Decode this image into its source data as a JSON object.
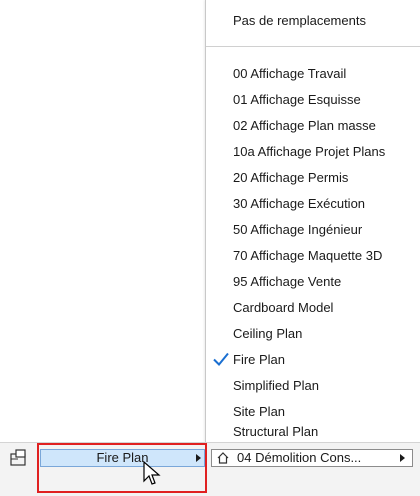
{
  "menu": {
    "header_item": "Pas de remplacements",
    "items": [
      {
        "label": "00 Affichage Travail",
        "checked": false
      },
      {
        "label": "01 Affichage Esquisse",
        "checked": false
      },
      {
        "label": "02 Affichage Plan masse",
        "checked": false
      },
      {
        "label": "10a Affichage Projet Plans",
        "checked": false
      },
      {
        "label": "20 Affichage Permis",
        "checked": false
      },
      {
        "label": "30 Affichage Exécution",
        "checked": false
      },
      {
        "label": "50 Affichage Ingénieur",
        "checked": false
      },
      {
        "label": "70 Affichage Maquette 3D",
        "checked": false
      },
      {
        "label": "95 Affichage Vente",
        "checked": false
      },
      {
        "label": "Cardboard Model",
        "checked": false
      },
      {
        "label": "Ceiling Plan",
        "checked": false
      },
      {
        "label": "Fire Plan",
        "checked": true
      },
      {
        "label": "Simplified Plan",
        "checked": false
      },
      {
        "label": "Site Plan",
        "checked": false
      },
      {
        "label": "Structural Plan",
        "checked": false
      }
    ],
    "check_icon": "checkmark-icon",
    "check_color": "#1a6fd1"
  },
  "bottombar": {
    "left_icon": "layout-icon",
    "override_field": "Fire Plan",
    "renovation_icon": "house-icon",
    "renovation_field": "04 Démolition Cons..."
  },
  "highlight_color": "#e02020"
}
